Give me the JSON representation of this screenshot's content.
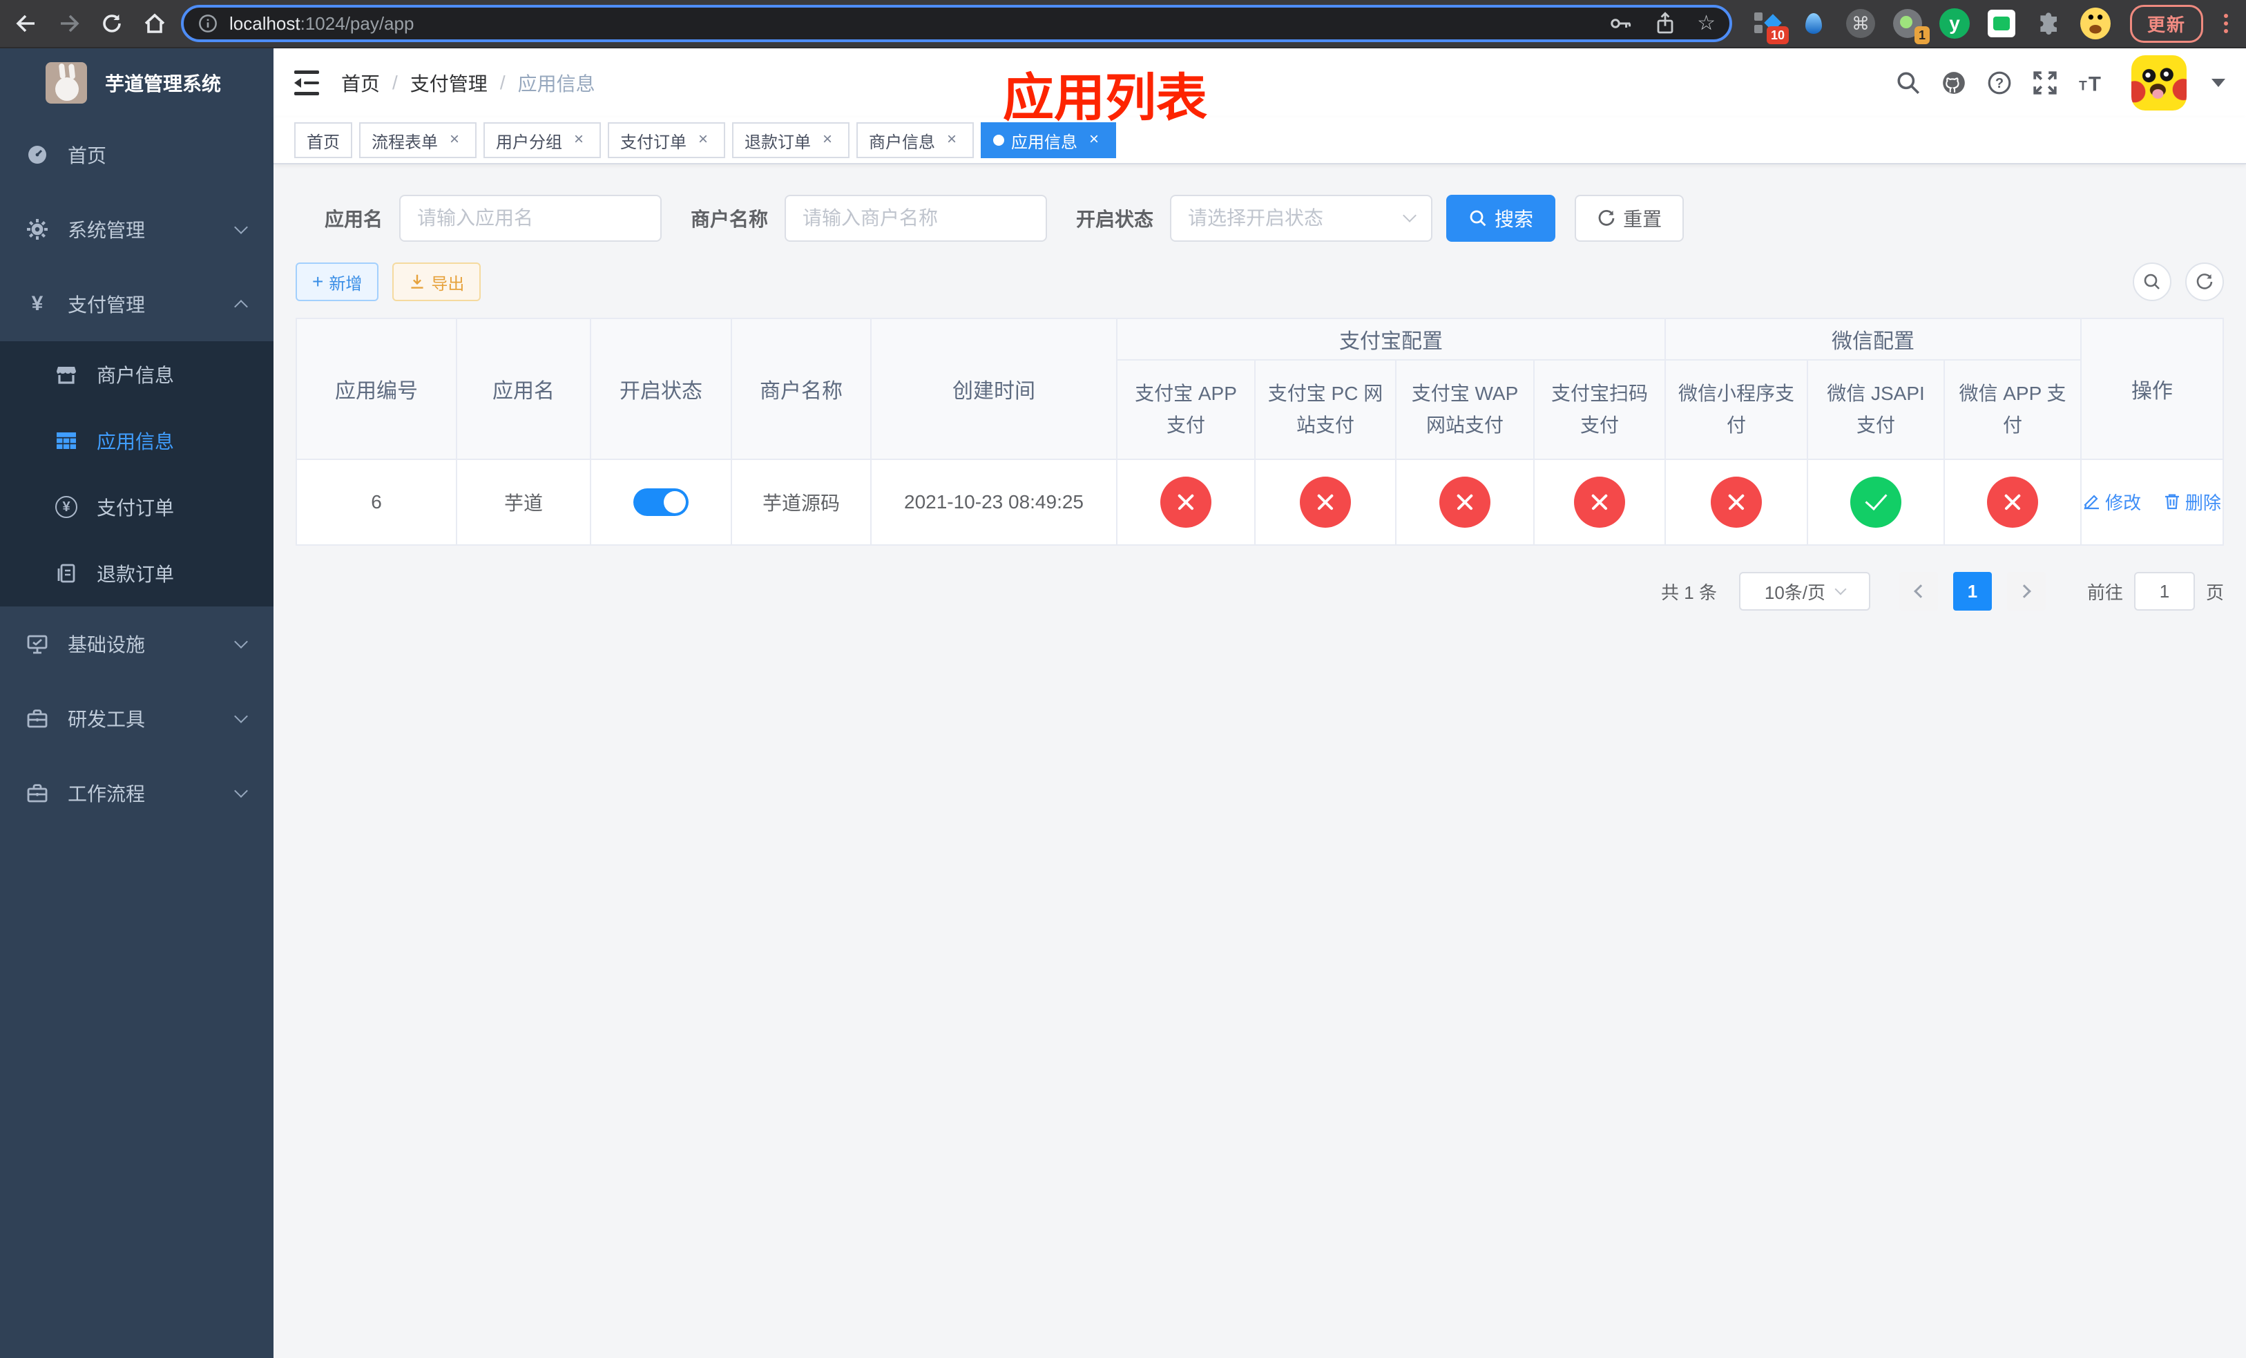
{
  "browser": {
    "url_host": "localhost",
    "url_rest": ":1024/pay/app",
    "update_label": "更新",
    "ext_badge_count": "10",
    "tab_badge_count": "1"
  },
  "sidebar": {
    "title": "芋道管理系统",
    "items": {
      "home": "首页",
      "system": "系统管理",
      "payment": "支付管理",
      "infra": "基础设施",
      "devtools": "研发工具",
      "workflow": "工作流程"
    },
    "sub_items": {
      "merchant": "商户信息",
      "app": "应用信息",
      "pay_order": "支付订单",
      "refund_order": "退款订单"
    }
  },
  "header": {
    "breadcrumb": [
      "首页",
      "支付管理",
      "应用信息"
    ]
  },
  "overlay_title": "应用列表",
  "tags": [
    "首页",
    "流程表单",
    "用户分组",
    "支付订单",
    "退款订单",
    "商户信息",
    "应用信息"
  ],
  "filter": {
    "app_name_label": "应用名",
    "app_name_placeholder": "请输入应用名",
    "merchant_label": "商户名称",
    "merchant_placeholder": "请输入商户名称",
    "status_label": "开启状态",
    "status_placeholder": "请选择开启状态",
    "search_label": "搜索",
    "reset_label": "重置"
  },
  "toolbar": {
    "add_label": "新增",
    "export_label": "导出"
  },
  "table": {
    "headers": {
      "app_id": "应用编号",
      "app_name": "应用名",
      "open_status": "开启状态",
      "merchant_name": "商户名称",
      "create_time": "创建时间",
      "alipay_group": "支付宝配置",
      "wechat_group": "微信配置",
      "actions": "操作",
      "channels": [
        "支付宝 APP 支付",
        "支付宝 PC 网站支付",
        "支付宝 WAP 网站支付",
        "支付宝扫码支付",
        "微信小程序支付",
        "微信 JSAPI 支付",
        "微信 APP 支付"
      ]
    },
    "row": {
      "app_id": "6",
      "app_name": "芋道",
      "open": true,
      "merchant_name": "芋道源码",
      "create_time": "2021-10-23 08:49:25",
      "channel_states": [
        "off",
        "off",
        "off",
        "off",
        "off",
        "on",
        "off"
      ],
      "edit_label": "修改",
      "delete_label": "删除"
    }
  },
  "pagination": {
    "total": "共 1 条",
    "page_size": "10条/页",
    "current_page": "1",
    "goto_label": "前往",
    "page_unit": "页"
  }
}
